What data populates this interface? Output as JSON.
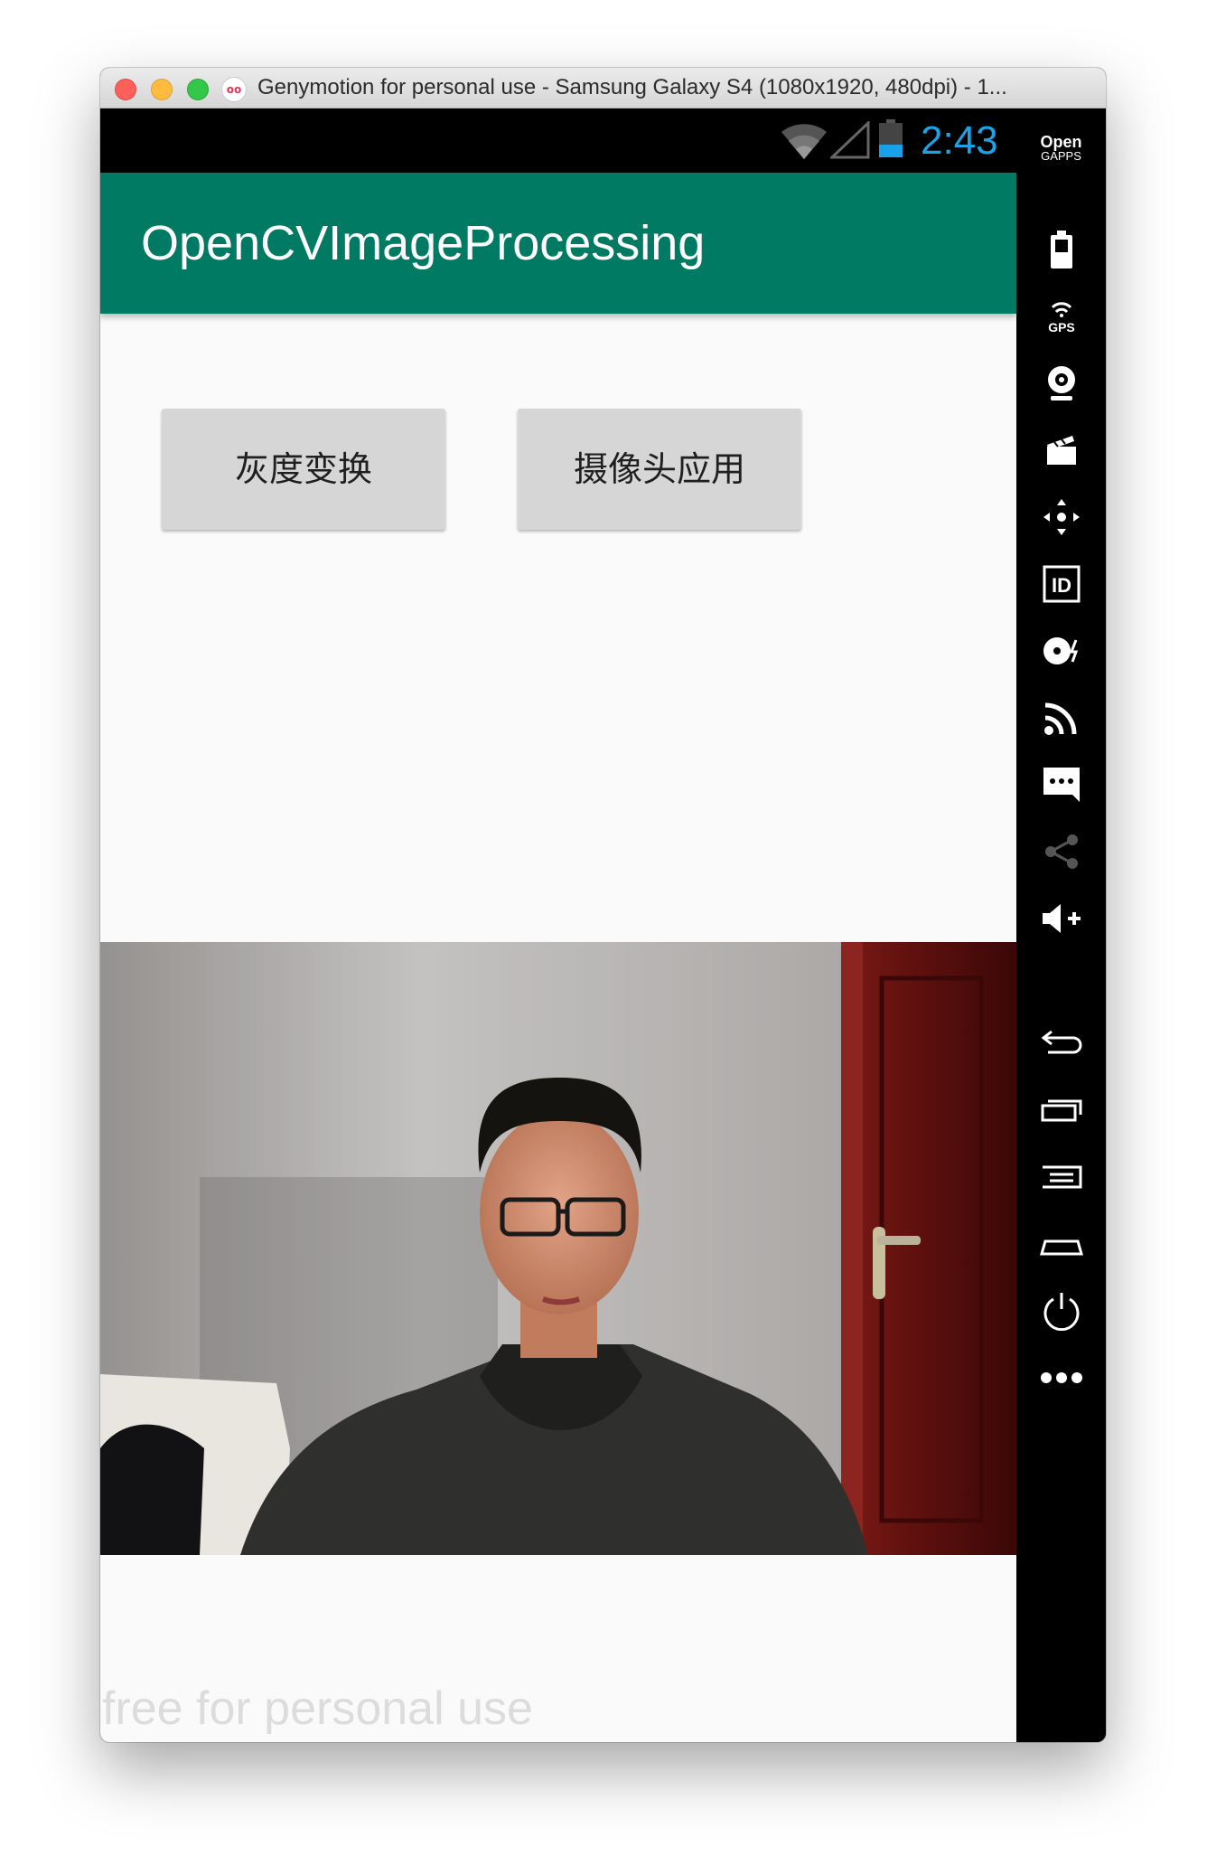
{
  "window": {
    "title": "Genymotion for personal use - Samsung Galaxy S4 (1080x1920, 480dpi) - 1...",
    "logo_text": "oo"
  },
  "status_bar": {
    "time": "2:43",
    "icons": [
      "wifi-icon",
      "signal-icon",
      "battery-icon"
    ],
    "time_color": "#1aa3e6"
  },
  "app": {
    "title": "OpenCVImageProcessing",
    "accent_color": "#007a63",
    "buttons": {
      "grayscale": "灰度变换",
      "camera": "摄像头应用"
    }
  },
  "watermark": "free for personal use",
  "sidebar": {
    "gapps_line1": "Open",
    "gapps_line2": "GAPPS",
    "gps_label": "GPS",
    "id_label": "ID",
    "icons": [
      "battery-widget-icon",
      "gps-widget-icon",
      "webcam-icon",
      "capture-icon",
      "dpad-icon",
      "device-id-icon",
      "disk-io-icon",
      "remote-control-icon",
      "sms-icon",
      "share-icon",
      "volume-up-icon",
      "volume-down-icon",
      "rotate-icon",
      "back-icon",
      "recent-apps-icon",
      "menu-icon",
      "home-icon",
      "power-icon",
      "more-icon"
    ]
  }
}
